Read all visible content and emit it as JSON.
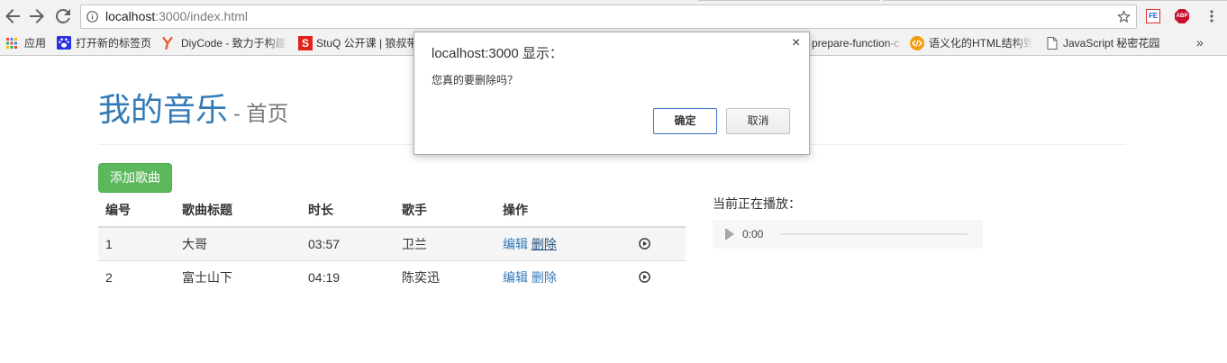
{
  "browser": {
    "toolbar": {
      "back_icon": "arrow-left-icon",
      "forward_icon": "arrow-right-icon",
      "reload_icon": "reload-icon",
      "menu_icon": "three-dots-vertical-icon"
    },
    "omnibox": {
      "info_icon": "info-circle-icon",
      "url_host": "localhost",
      "url_rest": ":3000/index.html",
      "bookmark_icon": "star-outline-icon"
    },
    "extensions": [
      {
        "label": "FE",
        "icon": "fehelper-icon"
      },
      {
        "label": "ABP",
        "icon": "adblock-plus-icon"
      }
    ]
  },
  "bookmarks": {
    "apps": {
      "label": "应用",
      "icon": "apps-grid-icon"
    },
    "items": [
      {
        "label": "打开新的标签页",
        "icon": "baidu-paw-icon"
      },
      {
        "label": "DiyCode - 致力于构建",
        "icon": "diycode-icon"
      },
      {
        "label": "StuQ 公开课 | 狼叔带",
        "icon": "stuq-icon",
        "icon_text": "S"
      },
      {
        "label": "prepare-function-c"
      },
      {
        "label": "语义化的HTML结构到",
        "icon": "code-circle-icon"
      },
      {
        "label": "JavaScript 秘密花园",
        "icon": "page-icon"
      }
    ],
    "overflow": "»"
  },
  "page": {
    "title": "我的音乐",
    "subtitle": "- 首页",
    "add_button": "添加歌曲",
    "table": {
      "headers": [
        "编号",
        "歌曲标题",
        "时长",
        "歌手",
        "操作"
      ],
      "actions": {
        "edit": "编辑",
        "delete": "删除",
        "play_icon": "play-circle-icon"
      },
      "rows": [
        {
          "id": "1",
          "title": "大哥",
          "duration": "03:57",
          "singer": "卫兰"
        },
        {
          "id": "2",
          "title": "富士山下",
          "duration": "04:19",
          "singer": "陈奕迅"
        }
      ]
    },
    "player": {
      "label": "当前正在播放：",
      "current_time": "0:00",
      "progress": 0,
      "play_icon": "play-triangle-icon"
    }
  },
  "dialog": {
    "title": "localhost:3000 显示：",
    "message": "您真的要删除吗？",
    "confirm": "确定",
    "cancel": "取消",
    "close": "×"
  },
  "colors": {
    "link": "#337ab7",
    "link_hover": "#23527c",
    "success": "#5cb85c",
    "title_secondary": "#777777",
    "dialog_focus": "#3b6fc4"
  }
}
